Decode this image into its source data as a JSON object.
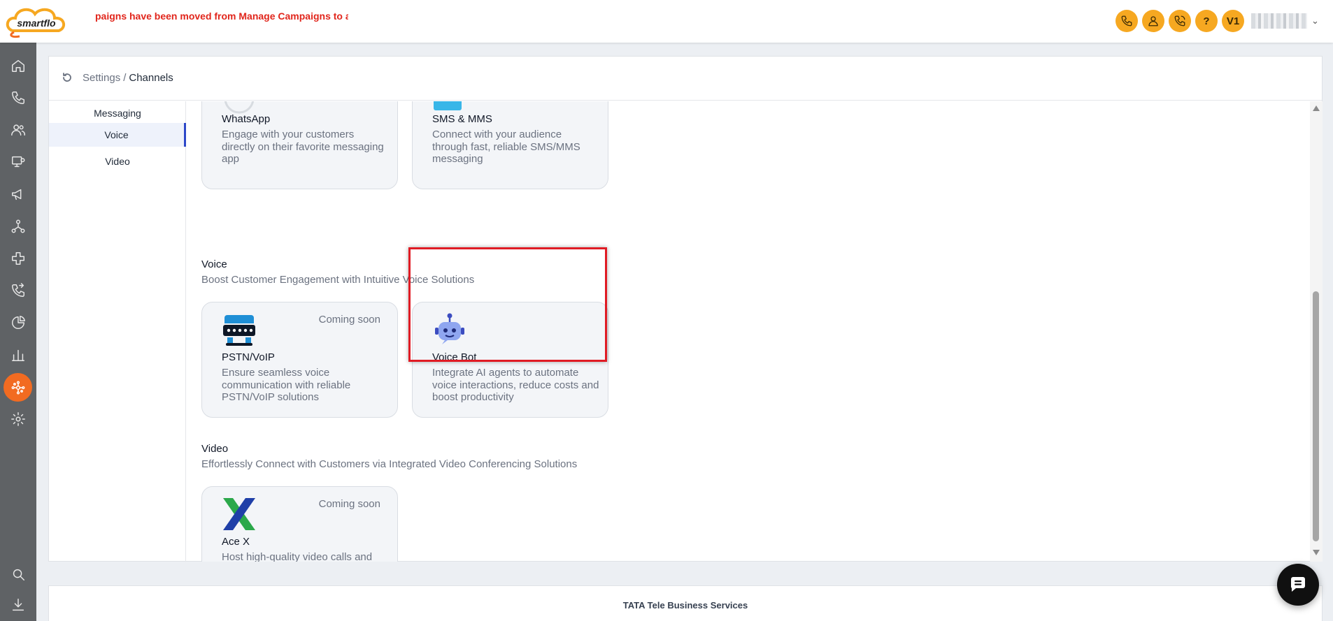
{
  "app": {
    "logo_text": "smartflo"
  },
  "announcement": "paigns have been moved from Manage Campaigns to a ne",
  "topbar": {
    "user_initials": "V1",
    "help_label": "?"
  },
  "breadcrumb": {
    "parent": "Settings",
    "separator": "/",
    "current": "Channels"
  },
  "subnav": {
    "items": [
      {
        "label": "Messaging"
      },
      {
        "label": "Voice"
      },
      {
        "label": "Video"
      }
    ]
  },
  "sections": {
    "messaging": {
      "cards": [
        {
          "name": "WhatsApp",
          "desc": "Engage with your customers directly on their favorite messaging app"
        },
        {
          "name": "SMS & MMS",
          "desc": "Connect with your audience through fast, reliable SMS/MMS messaging"
        }
      ]
    },
    "voice": {
      "title": "Voice",
      "subtitle": "Boost Customer Engagement with Intuitive Voice Solutions",
      "cards": [
        {
          "name": "PSTN/VoIP",
          "desc": "Ensure seamless voice communication with reliable PSTN/VoIP solutions",
          "badge": "Coming soon"
        },
        {
          "name": "Voice Bot",
          "desc": "Integrate AI agents to automate voice interactions, reduce costs and boost productivity"
        }
      ]
    },
    "video": {
      "title": "Video",
      "subtitle": "Effortlessly Connect with Customers via Integrated Video Conferencing Solutions",
      "cards": [
        {
          "name": "Ace X",
          "desc": "Host high-quality video calls and meetings directly from your platform",
          "badge": "Coming soon"
        }
      ]
    }
  },
  "footer": {
    "text": "TATA Tele Business Services"
  },
  "colors": {
    "accent": "#f26b21",
    "topbar_button": "#f6a821",
    "alert": "#e1261c",
    "active_nav": "#2d48c9"
  }
}
